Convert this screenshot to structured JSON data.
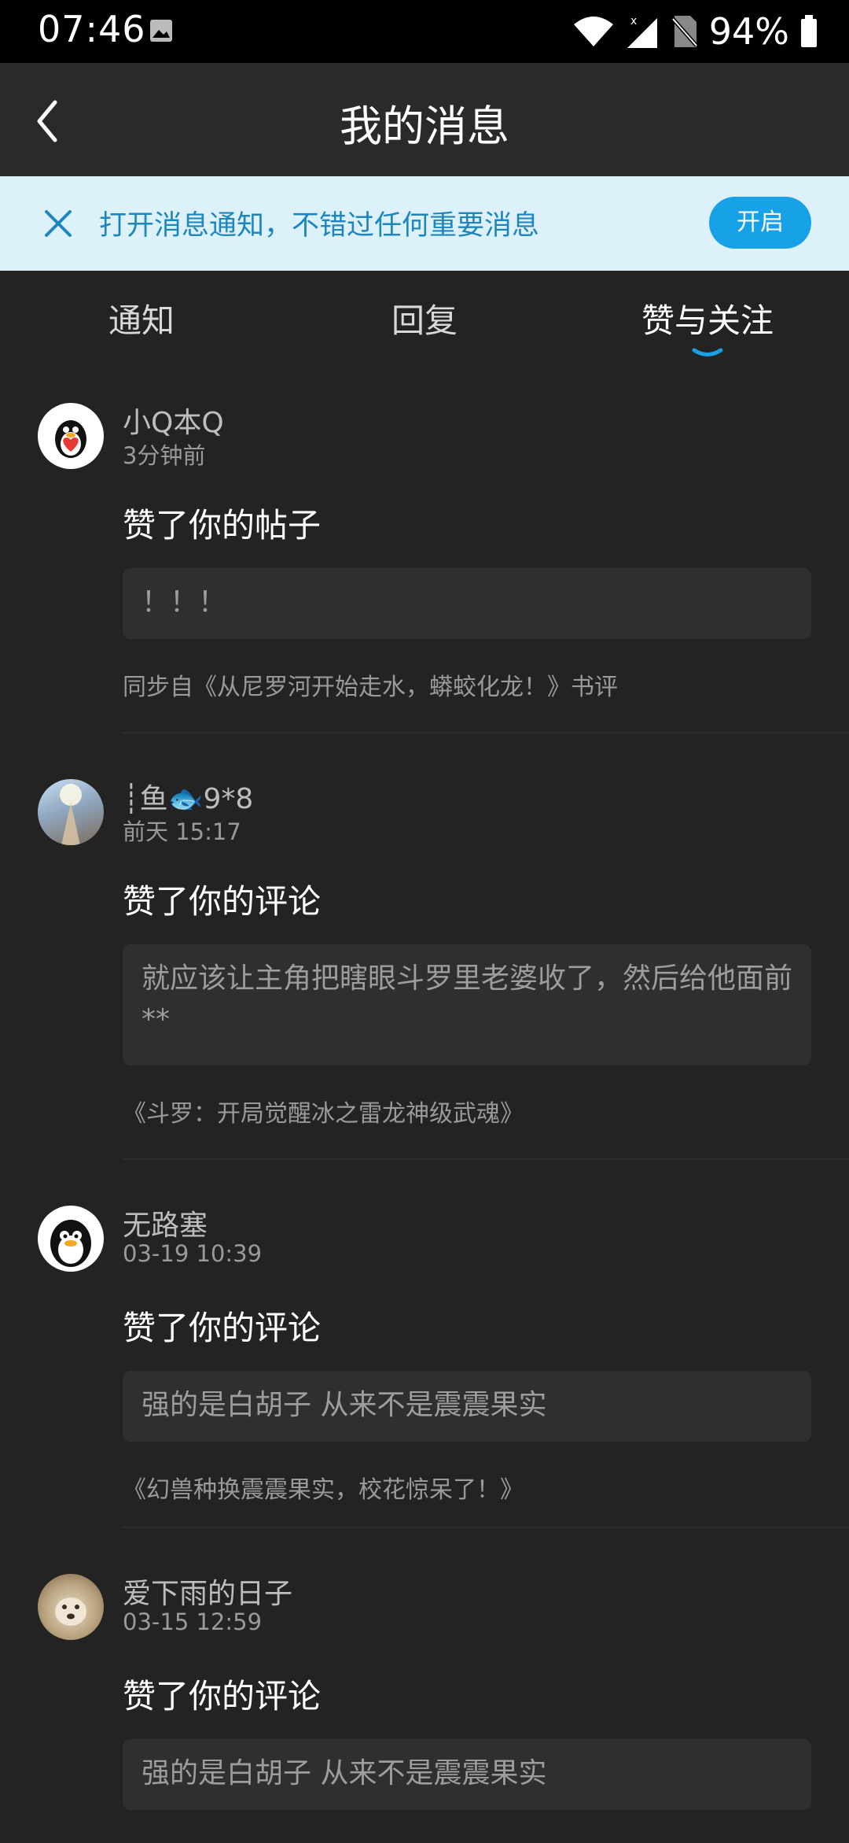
{
  "status_bar": {
    "time": "07:46",
    "battery": "94%",
    "icons": [
      "gallery-icon",
      "wifi-icon",
      "signal-icon",
      "no-sim-icon",
      "battery-icon"
    ]
  },
  "header": {
    "title": "我的消息",
    "back_icon": "back-chevron-icon"
  },
  "notice": {
    "text": "打开消息通知，不错过任何重要消息",
    "button": "开启",
    "close_icon": "close-icon",
    "accent": "#17a2e8"
  },
  "tabs": [
    {
      "label": "通知",
      "active": false
    },
    {
      "label": "回复",
      "active": false
    },
    {
      "label": "赞与关注",
      "active": true
    }
  ],
  "feed": [
    {
      "user": "小Q本Q",
      "time": "3分钟前",
      "action": "赞了你的帖子",
      "quote": "！！！",
      "source": "同步自《从尼罗河开始走水，蟒蛟化龙！》书评",
      "avatar_icon": "penguin-heart-avatar"
    },
    {
      "user": "┊鱼🐟9*8",
      "time": "前天 15:17",
      "action": "赞了你的评论",
      "quote": "就应该让主角把瞎眼斗罗里老婆收了，然后给他面前**",
      "source": "《斗罗：开局觉醒冰之雷龙神级武魂》",
      "avatar_icon": "sky-avatar"
    },
    {
      "user": "无路塞",
      "time": "03-19 10:39",
      "action": "赞了你的评论",
      "quote": "强的是白胡子 从来不是震震果实",
      "source": "《幻兽种换震震果实，校花惊呆了！》",
      "avatar_icon": "penguin-avatar"
    },
    {
      "user": "爱下雨的日子",
      "time": "03-15 12:59",
      "action": "赞了你的评论",
      "quote": "强的是白胡子 从来不是震震果实",
      "source": "",
      "avatar_icon": "puppy-avatar"
    }
  ]
}
